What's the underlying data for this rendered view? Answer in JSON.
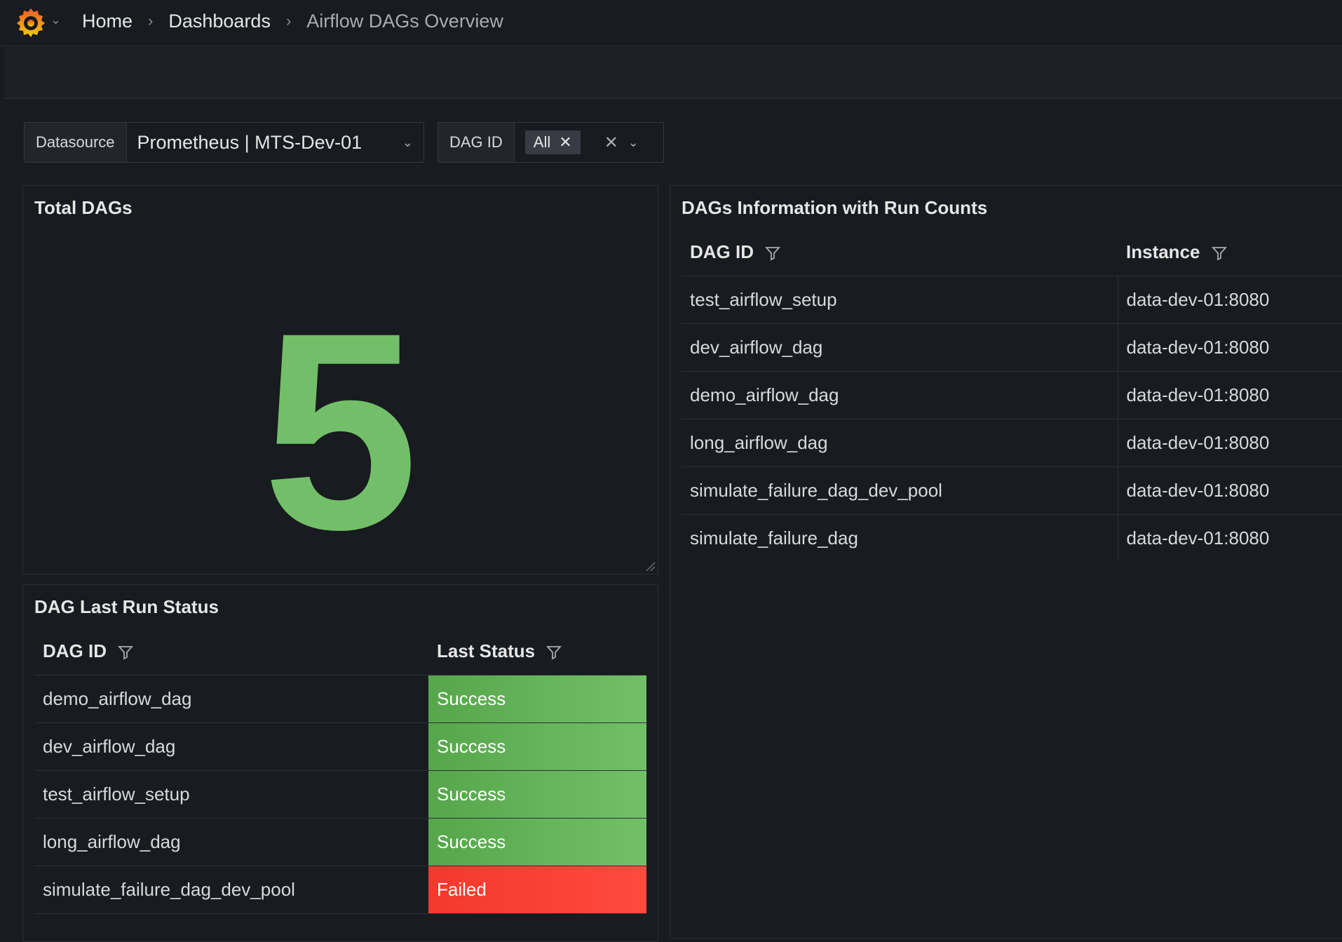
{
  "breadcrumb": {
    "items": [
      "Home",
      "Dashboards"
    ],
    "current": "Airflow DAGs Overview"
  },
  "icons": {
    "logo": "grafana-logo-icon",
    "logo_menu": "chevron-down-icon",
    "separator": "chevron-right-icon",
    "filter": "filter-icon",
    "clear": "close-icon",
    "resize": "resize-handle-icon"
  },
  "variables": {
    "datasource": {
      "label": "Datasource",
      "value": "Prometheus | MTS-Dev-01"
    },
    "dag_id": {
      "label": "DAG ID",
      "chip": "All"
    }
  },
  "total_dags_panel": {
    "title": "Total DAGs",
    "value": "5",
    "value_color": "#73bf69"
  },
  "info_panel": {
    "title": "DAGs Information with Run Counts",
    "columns": [
      "DAG ID",
      "Instance"
    ],
    "rows": [
      [
        "test_airflow_setup",
        "data-dev-01:8080"
      ],
      [
        "dev_airflow_dag",
        "data-dev-01:8080"
      ],
      [
        "demo_airflow_dag",
        "data-dev-01:8080"
      ],
      [
        "long_airflow_dag",
        "data-dev-01:8080"
      ],
      [
        "simulate_failure_dag_dev_pool",
        "data-dev-01:8080"
      ],
      [
        "simulate_failure_dag",
        "data-dev-01:8080"
      ]
    ]
  },
  "status_panel": {
    "title": "DAG Last Run Status",
    "columns": [
      "DAG ID",
      "Last Status"
    ],
    "rows": [
      {
        "dag": "demo_airflow_dag",
        "status": "Success",
        "kind": "success"
      },
      {
        "dag": "dev_airflow_dag",
        "status": "Success",
        "kind": "success"
      },
      {
        "dag": "test_airflow_setup",
        "status": "Success",
        "kind": "success"
      },
      {
        "dag": "long_airflow_dag",
        "status": "Success",
        "kind": "success"
      },
      {
        "dag": "simulate_failure_dag_dev_pool",
        "status": "Failed",
        "kind": "failed"
      }
    ],
    "colors": {
      "success": "#73bf69",
      "failed": "#f2392c"
    }
  }
}
